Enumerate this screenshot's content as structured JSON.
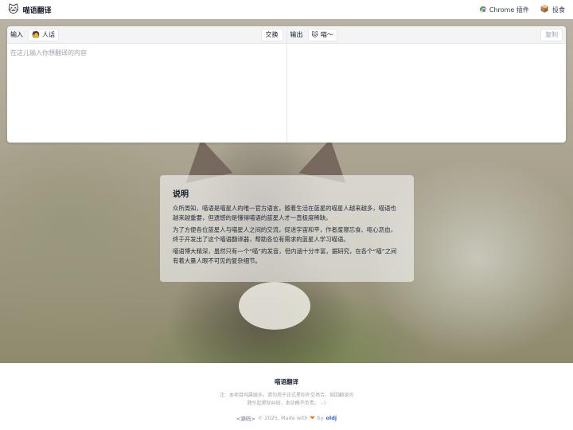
{
  "header": {
    "brand_icon": "🐱",
    "title": "喵语翻译",
    "links": [
      {
        "label": "Chrome 插件",
        "icon": "chrome-icon"
      },
      {
        "label": "投食",
        "icon": "gift-icon"
      }
    ]
  },
  "translator": {
    "input": {
      "label": "输入",
      "lang_icon": "🧑",
      "lang": "人话",
      "swap_label": "交换",
      "placeholder": "在这儿输入你想翻译的内容",
      "value": ""
    },
    "output": {
      "label": "输出",
      "lang_icon": "🐱",
      "lang": "喵～",
      "copy_label": "复制",
      "value": ""
    }
  },
  "description": {
    "title": "说明",
    "paragraphs": [
      "众所周知，喵语是喵星人的唯一官方语言，随着生活在蓝星的喵星人越来越多，喵语也越来越重要，但遗憾的是懂得喵语的蓝星人才一直极度稀缺。",
      "为了方便各位蓝星人与喵星人之间的交流，促进宇宙和平，作者废寝忘食、呕心沥血，终于开发出了这个喵语翻译器，帮助各位有需求的蓝星人学习喵语。",
      "喵语博大精深，虽然只有一个“喵”的发音，但内涵十分丰富，据研究，在各个“喵”之间有着大量人眼不可见的复杂细节。"
    ]
  },
  "footer": {
    "title": "喵语翻译",
    "note": "注：本项目纯属娱乐，请勿用于正式星际外交场合，如因翻译问题引起星际纠纷，本站概不负责。 :-)",
    "source_label": "<源码>",
    "copyright": "© 2025, Made with",
    "by": "by",
    "author": "oldj",
    "accent_color": "#f97316"
  }
}
